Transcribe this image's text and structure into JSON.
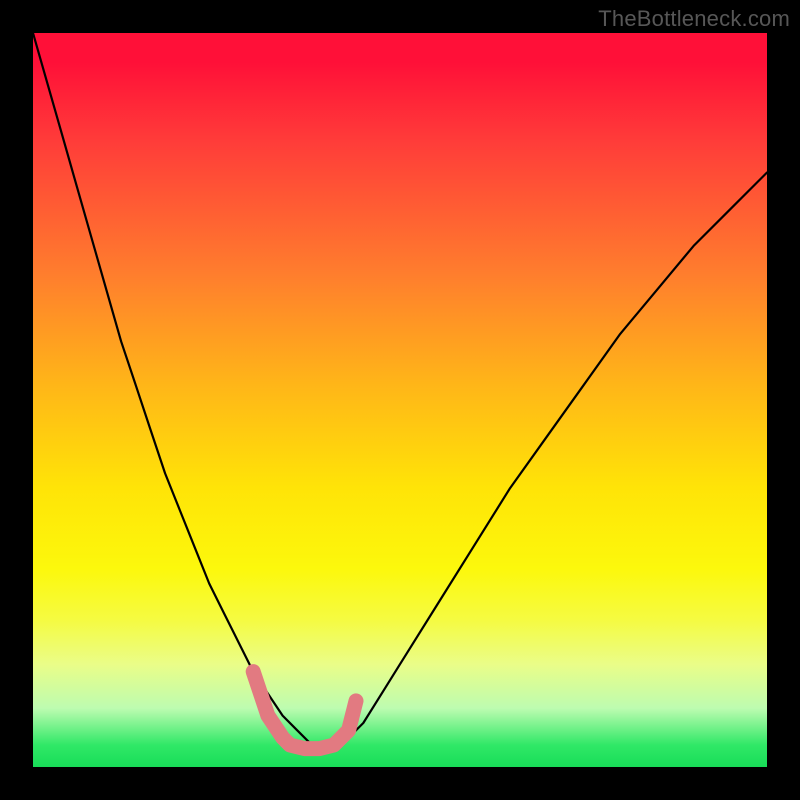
{
  "watermark": "TheBottleneck.com",
  "colors": {
    "frame": "#000000",
    "curve": "#000000",
    "marker": "#e27a81",
    "gradient_top": "#ff1038",
    "gradient_bottom": "#18dd58"
  },
  "chart_data": {
    "type": "line",
    "title": "",
    "xlabel": "",
    "ylabel": "",
    "xlim": [
      0,
      100
    ],
    "ylim": [
      0,
      100
    ],
    "x": [
      0,
      2,
      4,
      6,
      8,
      10,
      12,
      14,
      16,
      18,
      20,
      22,
      24,
      26,
      28,
      30,
      32,
      34,
      36,
      38,
      40,
      42,
      45,
      50,
      55,
      60,
      65,
      70,
      75,
      80,
      85,
      90,
      95,
      100
    ],
    "values": [
      100,
      93,
      86,
      79,
      72,
      65,
      58,
      52,
      46,
      40,
      35,
      30,
      25,
      21,
      17,
      13,
      10,
      7,
      5,
      3,
      2,
      3,
      6,
      14,
      22,
      30,
      38,
      45,
      52,
      59,
      65,
      71,
      76,
      81
    ],
    "series": [
      {
        "name": "bottleneck-curve",
        "x": [
          0,
          2,
          4,
          6,
          8,
          10,
          12,
          14,
          16,
          18,
          20,
          22,
          24,
          26,
          28,
          30,
          32,
          34,
          36,
          38,
          40,
          42,
          45,
          50,
          55,
          60,
          65,
          70,
          75,
          80,
          85,
          90,
          95,
          100
        ],
        "y": [
          100,
          93,
          86,
          79,
          72,
          65,
          58,
          52,
          46,
          40,
          35,
          30,
          25,
          21,
          17,
          13,
          10,
          7,
          5,
          3,
          2,
          3,
          6,
          14,
          22,
          30,
          38,
          45,
          52,
          59,
          65,
          71,
          76,
          81
        ]
      }
    ],
    "marker": {
      "x": [
        30,
        32,
        34,
        35,
        37,
        39,
        41,
        43,
        44
      ],
      "y": [
        13,
        7,
        4,
        3,
        2.5,
        2.5,
        3,
        5,
        9
      ]
    }
  }
}
